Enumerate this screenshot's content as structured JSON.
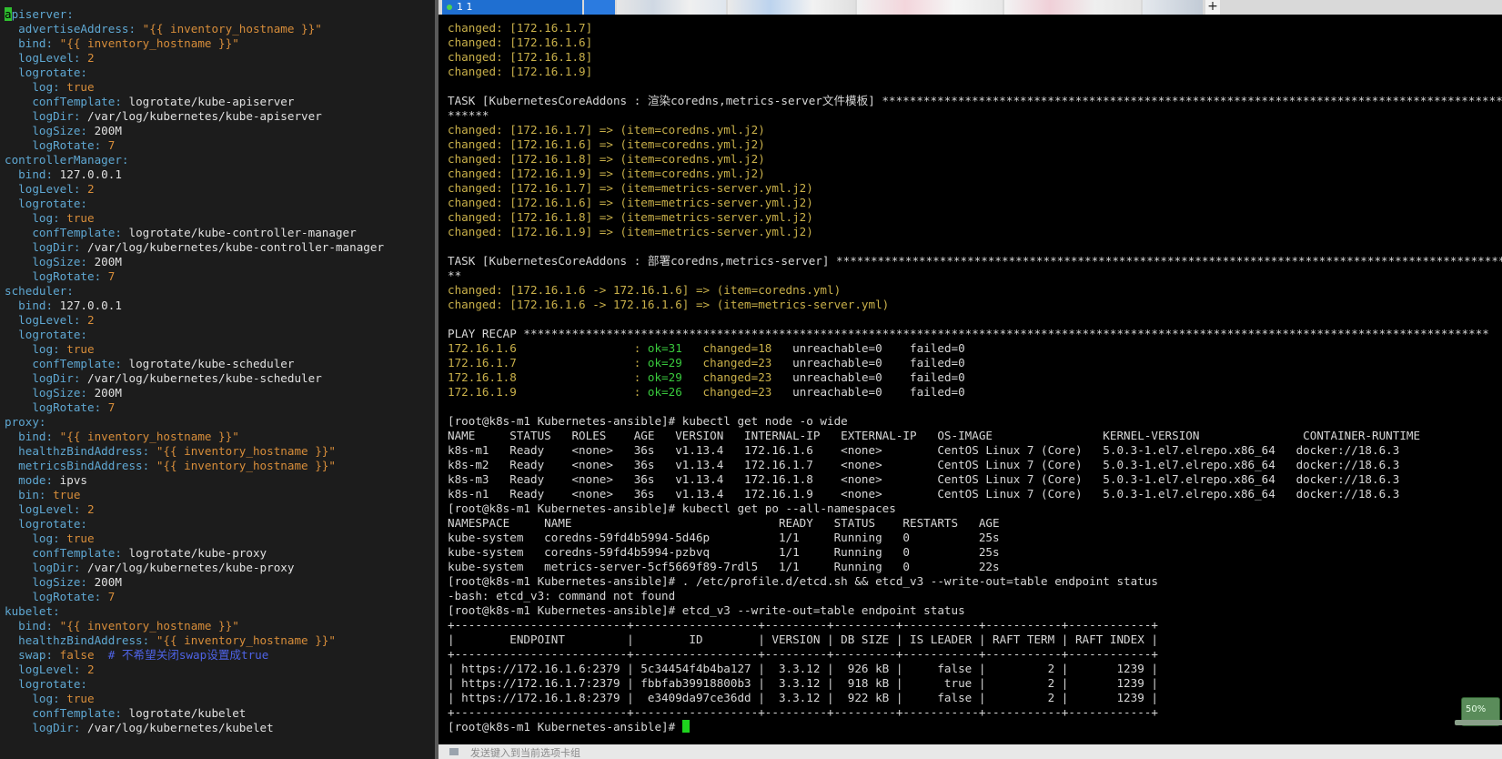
{
  "tab": {
    "active_label": "1 1"
  },
  "tab_add_label": "+",
  "left_pane": {
    "lines": [
      [
        {
          "t": "a",
          "c": "cur"
        },
        {
          "t": "piserver:",
          "c": "k"
        }
      ],
      [
        {
          "t": "  advertiseAddress: ",
          "c": "k"
        },
        {
          "t": "\"{{ inventory_hostname }}\"",
          "c": "s"
        }
      ],
      [
        {
          "t": "  bind: ",
          "c": "k"
        },
        {
          "t": "\"{{ inventory_hostname }}\"",
          "c": "s"
        }
      ],
      [
        {
          "t": "  logLevel: ",
          "c": "k"
        },
        {
          "t": "2",
          "c": "n"
        }
      ],
      [
        {
          "t": "  logrotate:",
          "c": "k"
        }
      ],
      [
        {
          "t": "    log: ",
          "c": "k"
        },
        {
          "t": "true",
          "c": "n"
        }
      ],
      [
        {
          "t": "    confTemplate: ",
          "c": "k"
        },
        {
          "t": "logrotate/kube-apiserver",
          "c": "v"
        }
      ],
      [
        {
          "t": "    logDir: ",
          "c": "k"
        },
        {
          "t": "/var/log/kubernetes/kube-apiserver",
          "c": "v"
        }
      ],
      [
        {
          "t": "    logSize: ",
          "c": "k"
        },
        {
          "t": "200M",
          "c": "v"
        }
      ],
      [
        {
          "t": "    logRotate: ",
          "c": "k"
        },
        {
          "t": "7",
          "c": "n"
        }
      ],
      [
        {
          "t": "controllerManager:",
          "c": "k"
        }
      ],
      [
        {
          "t": "  bind: ",
          "c": "k"
        },
        {
          "t": "127.0.0.1",
          "c": "v"
        }
      ],
      [
        {
          "t": "  logLevel: ",
          "c": "k"
        },
        {
          "t": "2",
          "c": "n"
        }
      ],
      [
        {
          "t": "  logrotate:",
          "c": "k"
        }
      ],
      [
        {
          "t": "    log: ",
          "c": "k"
        },
        {
          "t": "true",
          "c": "n"
        }
      ],
      [
        {
          "t": "    confTemplate: ",
          "c": "k"
        },
        {
          "t": "logrotate/kube-controller-manager",
          "c": "v"
        }
      ],
      [
        {
          "t": "    logDir: ",
          "c": "k"
        },
        {
          "t": "/var/log/kubernetes/kube-controller-manager",
          "c": "v"
        }
      ],
      [
        {
          "t": "    logSize: ",
          "c": "k"
        },
        {
          "t": "200M",
          "c": "v"
        }
      ],
      [
        {
          "t": "    logRotate: ",
          "c": "k"
        },
        {
          "t": "7",
          "c": "n"
        }
      ],
      [
        {
          "t": "scheduler:",
          "c": "k"
        }
      ],
      [
        {
          "t": "  bind: ",
          "c": "k"
        },
        {
          "t": "127.0.0.1",
          "c": "v"
        }
      ],
      [
        {
          "t": "  logLevel: ",
          "c": "k"
        },
        {
          "t": "2",
          "c": "n"
        }
      ],
      [
        {
          "t": "  logrotate:",
          "c": "k"
        }
      ],
      [
        {
          "t": "    log: ",
          "c": "k"
        },
        {
          "t": "true",
          "c": "n"
        }
      ],
      [
        {
          "t": "    confTemplate: ",
          "c": "k"
        },
        {
          "t": "logrotate/kube-scheduler",
          "c": "v"
        }
      ],
      [
        {
          "t": "    logDir: ",
          "c": "k"
        },
        {
          "t": "/var/log/kubernetes/kube-scheduler",
          "c": "v"
        }
      ],
      [
        {
          "t": "    logSize: ",
          "c": "k"
        },
        {
          "t": "200M",
          "c": "v"
        }
      ],
      [
        {
          "t": "    logRotate: ",
          "c": "k"
        },
        {
          "t": "7",
          "c": "n"
        }
      ],
      [
        {
          "t": "proxy:",
          "c": "k"
        }
      ],
      [
        {
          "t": "  bind: ",
          "c": "k"
        },
        {
          "t": "\"{{ inventory_hostname }}\"",
          "c": "s"
        }
      ],
      [
        {
          "t": "  healthzBindAddress: ",
          "c": "k"
        },
        {
          "t": "\"{{ inventory_hostname }}\"",
          "c": "s"
        }
      ],
      [
        {
          "t": "  metricsBindAddress: ",
          "c": "k"
        },
        {
          "t": "\"{{ inventory_hostname }}\"",
          "c": "s"
        }
      ],
      [
        {
          "t": "  mode: ",
          "c": "k"
        },
        {
          "t": "ipvs",
          "c": "v"
        }
      ],
      [
        {
          "t": "  bin: ",
          "c": "k"
        },
        {
          "t": "true",
          "c": "n"
        }
      ],
      [
        {
          "t": "  logLevel: ",
          "c": "k"
        },
        {
          "t": "2",
          "c": "n"
        }
      ],
      [
        {
          "t": "  logrotate:",
          "c": "k"
        }
      ],
      [
        {
          "t": "    log: ",
          "c": "k"
        },
        {
          "t": "true",
          "c": "n"
        }
      ],
      [
        {
          "t": "    confTemplate: ",
          "c": "k"
        },
        {
          "t": "logrotate/kube-proxy",
          "c": "v"
        }
      ],
      [
        {
          "t": "    logDir: ",
          "c": "k"
        },
        {
          "t": "/var/log/kubernetes/kube-proxy",
          "c": "v"
        }
      ],
      [
        {
          "t": "    logSize: ",
          "c": "k"
        },
        {
          "t": "200M",
          "c": "v"
        }
      ],
      [
        {
          "t": "    logRotate: ",
          "c": "k"
        },
        {
          "t": "7",
          "c": "n"
        }
      ],
      [
        {
          "t": "kubelet:",
          "c": "k"
        }
      ],
      [
        {
          "t": "  bind: ",
          "c": "k"
        },
        {
          "t": "\"{{ inventory_hostname }}\"",
          "c": "s"
        }
      ],
      [
        {
          "t": "  healthzBindAddress: ",
          "c": "k"
        },
        {
          "t": "\"{{ inventory_hostname }}\"",
          "c": "s"
        }
      ],
      [
        {
          "t": "  swap: ",
          "c": "k"
        },
        {
          "t": "false",
          "c": "n"
        },
        {
          "t": "  # 不希望关闭swap设置成true",
          "c": "c"
        }
      ],
      [
        {
          "t": "  logLevel: ",
          "c": "k"
        },
        {
          "t": "2",
          "c": "n"
        }
      ],
      [
        {
          "t": "  logrotate:",
          "c": "k"
        }
      ],
      [
        {
          "t": "    log: ",
          "c": "k"
        },
        {
          "t": "true",
          "c": "n"
        }
      ],
      [
        {
          "t": "    confTemplate: ",
          "c": "k"
        },
        {
          "t": "logrotate/kubelet",
          "c": "v"
        }
      ],
      [
        {
          "t": "    logDir: ",
          "c": "k"
        },
        {
          "t": "/var/log/kubernetes/kubelet",
          "c": "v"
        }
      ]
    ]
  },
  "terminal": {
    "lines": [
      [
        {
          "t": "changed: [172.16.1.7]",
          "c": "y"
        }
      ],
      [
        {
          "t": "changed: [172.16.1.6]",
          "c": "y"
        }
      ],
      [
        {
          "t": "changed: [172.16.1.8]",
          "c": "y"
        }
      ],
      [
        {
          "t": "changed: [172.16.1.9]",
          "c": "y"
        }
      ],
      [
        {
          "t": "",
          "c": "w"
        }
      ],
      [
        {
          "t": "TASK [KubernetesCoreAddons : 渲染coredns,metrics-server文件模板] ********************************************************************************************",
          "c": "w"
        }
      ],
      [
        {
          "t": "******",
          "c": "w"
        }
      ],
      [
        {
          "t": "changed: [172.16.1.7] => (item=coredns.yml.j2)",
          "c": "y"
        }
      ],
      [
        {
          "t": "changed: [172.16.1.6] => (item=coredns.yml.j2)",
          "c": "y"
        }
      ],
      [
        {
          "t": "changed: [172.16.1.8] => (item=coredns.yml.j2)",
          "c": "y"
        }
      ],
      [
        {
          "t": "changed: [172.16.1.9] => (item=coredns.yml.j2)",
          "c": "y"
        }
      ],
      [
        {
          "t": "changed: [172.16.1.7] => (item=metrics-server.yml.j2)",
          "c": "y"
        }
      ],
      [
        {
          "t": "changed: [172.16.1.6] => (item=metrics-server.yml.j2)",
          "c": "y"
        }
      ],
      [
        {
          "t": "changed: [172.16.1.8] => (item=metrics-server.yml.j2)",
          "c": "y"
        }
      ],
      [
        {
          "t": "changed: [172.16.1.9] => (item=metrics-server.yml.j2)",
          "c": "y"
        }
      ],
      [
        {
          "t": "",
          "c": "w"
        }
      ],
      [
        {
          "t": "TASK [KubernetesCoreAddons : 部署coredns,metrics-server] ****************************************************************************************************",
          "c": "w"
        }
      ],
      [
        {
          "t": "**",
          "c": "w"
        }
      ],
      [
        {
          "t": "changed: [172.16.1.6 -> 172.16.1.6] => (item=coredns.yml)",
          "c": "y"
        }
      ],
      [
        {
          "t": "changed: [172.16.1.6 -> 172.16.1.6] => (item=metrics-server.yml)",
          "c": "y"
        }
      ],
      [
        {
          "t": "",
          "c": "w"
        }
      ],
      [
        {
          "t": "PLAY RECAP ********************************************************************************************************************************************",
          "c": "w"
        }
      ],
      [
        {
          "t": "172.16.1.6                 : ",
          "c": "y"
        },
        {
          "t": "ok=31",
          "c": "g"
        },
        {
          "t": "   changed=18",
          "c": "y"
        },
        {
          "t": "   unreachable=0    failed=0",
          "c": "w"
        }
      ],
      [
        {
          "t": "172.16.1.7                 : ",
          "c": "y"
        },
        {
          "t": "ok=29",
          "c": "g"
        },
        {
          "t": "   changed=23",
          "c": "y"
        },
        {
          "t": "   unreachable=0    failed=0",
          "c": "w"
        }
      ],
      [
        {
          "t": "172.16.1.8                 : ",
          "c": "y"
        },
        {
          "t": "ok=29",
          "c": "g"
        },
        {
          "t": "   changed=23",
          "c": "y"
        },
        {
          "t": "   unreachable=0    failed=0",
          "c": "w"
        }
      ],
      [
        {
          "t": "172.16.1.9                 : ",
          "c": "y"
        },
        {
          "t": "ok=26",
          "c": "g"
        },
        {
          "t": "   changed=23",
          "c": "y"
        },
        {
          "t": "   unreachable=0    failed=0",
          "c": "w"
        }
      ],
      [
        {
          "t": "",
          "c": "w"
        }
      ],
      [
        {
          "t": "[root@k8s-m1 Kubernetes-ansible]# kubectl get node -o wide",
          "c": "w"
        }
      ],
      [
        {
          "t": "NAME     STATUS   ROLES    AGE   VERSION   INTERNAL-IP   EXTERNAL-IP   OS-IMAGE                KERNEL-VERSION               CONTAINER-RUNTIME",
          "c": "w"
        }
      ],
      [
        {
          "t": "k8s-m1   Ready    <none>   36s   v1.13.4   172.16.1.6    <none>        CentOS Linux 7 (Core)   5.0.3-1.el7.elrepo.x86_64   docker://18.6.3",
          "c": "w"
        }
      ],
      [
        {
          "t": "k8s-m2   Ready    <none>   36s   v1.13.4   172.16.1.7    <none>        CentOS Linux 7 (Core)   5.0.3-1.el7.elrepo.x86_64   docker://18.6.3",
          "c": "w"
        }
      ],
      [
        {
          "t": "k8s-m3   Ready    <none>   36s   v1.13.4   172.16.1.8    <none>        CentOS Linux 7 (Core)   5.0.3-1.el7.elrepo.x86_64   docker://18.6.3",
          "c": "w"
        }
      ],
      [
        {
          "t": "k8s-n1   Ready    <none>   36s   v1.13.4   172.16.1.9    <none>        CentOS Linux 7 (Core)   5.0.3-1.el7.elrepo.x86_64   docker://18.6.3",
          "c": "w"
        }
      ],
      [
        {
          "t": "[root@k8s-m1 Kubernetes-ansible]# kubectl get po --all-namespaces",
          "c": "w"
        }
      ],
      [
        {
          "t": "NAMESPACE     NAME                              READY   STATUS    RESTARTS   AGE",
          "c": "w"
        }
      ],
      [
        {
          "t": "kube-system   coredns-59fd4b5994-5d46p          1/1     Running   0          25s",
          "c": "w"
        }
      ],
      [
        {
          "t": "kube-system   coredns-59fd4b5994-pzbvq          1/1     Running   0          25s",
          "c": "w"
        }
      ],
      [
        {
          "t": "kube-system   metrics-server-5cf5669f89-7rdl5   1/1     Running   0          22s",
          "c": "w"
        }
      ],
      [
        {
          "t": "[root@k8s-m1 Kubernetes-ansible]# . /etc/profile.d/etcd.sh && etcd_v3 --write-out=table endpoint status",
          "c": "w"
        }
      ],
      [
        {
          "t": "-bash: etcd_v3: command not found",
          "c": "w"
        }
      ],
      [
        {
          "t": "[root@k8s-m1 Kubernetes-ansible]# etcd_v3 --write-out=table endpoint status",
          "c": "w"
        }
      ],
      [
        {
          "t": "+-------------------------+------------------+---------+---------+-----------+-----------+------------+",
          "c": "w"
        }
      ],
      [
        {
          "t": "|        ENDPOINT         |        ID        | VERSION | DB SIZE | IS LEADER | RAFT TERM | RAFT INDEX |",
          "c": "w"
        }
      ],
      [
        {
          "t": "+-------------------------+------------------+---------+---------+-----------+-----------+------------+",
          "c": "w"
        }
      ],
      [
        {
          "t": "| https://172.16.1.6:2379 | 5c34454f4b4ba127 |  3.3.12 |  926 kB |     false |         2 |       1239 |",
          "c": "w"
        }
      ],
      [
        {
          "t": "| https://172.16.1.7:2379 | fbbfab39918800b3 |  3.3.12 |  918 kB |      true |         2 |       1239 |",
          "c": "w"
        }
      ],
      [
        {
          "t": "| https://172.16.1.8:2379 |  e3409da97ce36dd |  3.3.12 |  922 kB |     false |         2 |       1239 |",
          "c": "w"
        }
      ],
      [
        {
          "t": "+-------------------------+------------------+---------+---------+-----------+-----------+------------+",
          "c": "w"
        }
      ],
      [
        {
          "t": "[root@k8s-m1 Kubernetes-ansible]# ",
          "c": "w"
        },
        {
          "t": "",
          "c": "cursor"
        }
      ]
    ]
  },
  "statusbar": {
    "hint": "发送键入到当前选项卡组"
  },
  "zoom_widget": {
    "value": "50%"
  },
  "colors": {
    "key": "#5fa8d3",
    "string": "#d78d3a",
    "changed": "#c9b04a",
    "ok": "#39c93d",
    "tab_active": "#1f6fd1"
  }
}
